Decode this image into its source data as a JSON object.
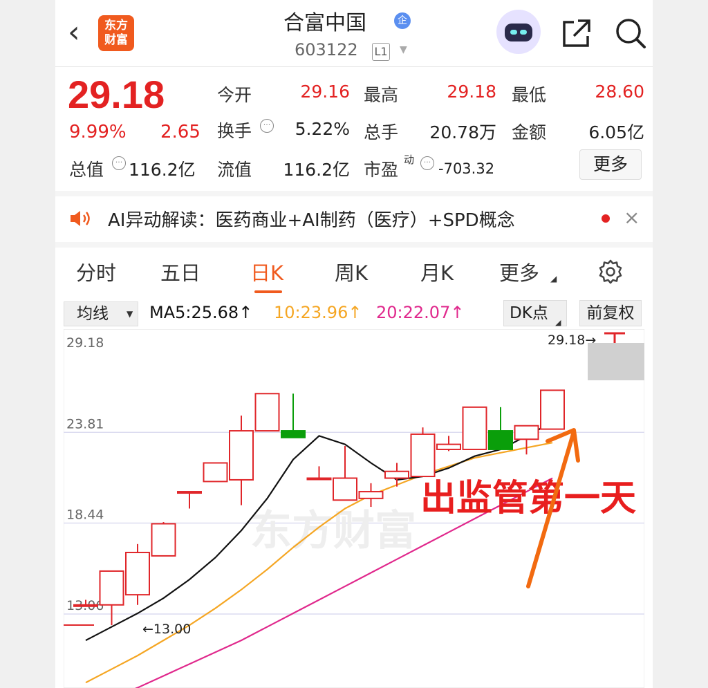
{
  "header": {
    "back_glyph": "‹",
    "logo_line1": "东方",
    "logo_line2": "财富",
    "title": "合富中国",
    "title_badge": "企",
    "code": "603122",
    "level": "L1"
  },
  "quote": {
    "price": "29.18",
    "change_pct": "9.99%",
    "change": "2.65",
    "stats": [
      {
        "label": "今开",
        "value": "29.16",
        "color": "#e32222"
      },
      {
        "label": "最高",
        "value": "29.18",
        "color": "#e32222"
      },
      {
        "label": "最低",
        "value": "28.60",
        "color": "#e32222"
      },
      {
        "label": "换手",
        "value": "5.22%",
        "color": "#222222"
      },
      {
        "label": "总手",
        "value": "20.78万",
        "color": "#222222"
      },
      {
        "label": "金额",
        "value": "6.05亿",
        "color": "#222222"
      },
      {
        "label": "总值",
        "value": "116.2亿",
        "color": "#222222"
      },
      {
        "label": "流值",
        "value": "116.2亿",
        "color": "#222222"
      },
      {
        "label": "市盈",
        "label_sup": "动",
        "value": "-703.32",
        "color": "#222222"
      }
    ],
    "more_label": "更多"
  },
  "ai_bar": {
    "text": "AI异动解读：医药商业+AI制药（医疗）+SPD概念",
    "close": "×"
  },
  "tabs": [
    "分时",
    "五日",
    "日K",
    "周K",
    "月K",
    "更多"
  ],
  "active_tab": "日K",
  "indicator": {
    "ma_selector": "均线",
    "ma5": "MA5:25.68↑",
    "ma10": "10:23.96↑",
    "ma20": "20:22.07↑",
    "ma5_color": "#111111",
    "ma10_color": "#f5a623",
    "ma20_color": "#e0288c",
    "dk_label": "DK点",
    "fq_label": "前复权"
  },
  "chart_data": {
    "type": "candlestick",
    "y_axis_labels": [
      "29.18",
      "23.81",
      "18.44",
      "13.06"
    ],
    "ylim": [
      11.0,
      29.18
    ],
    "annotations": {
      "high_label": "29.18→",
      "low_label": "←13.00",
      "overlay_text": "出监管第一天",
      "watermark": "东方财富"
    },
    "candles": [
      {
        "o": 13.6,
        "h": 13.9,
        "l": 13.6,
        "c": 13.6
      },
      {
        "o": 13.6,
        "h": 14.8,
        "l": 12.4,
        "c": 15.6
      },
      {
        "o": 14.2,
        "h": 17.2,
        "l": 13.6,
        "c": 16.7
      },
      {
        "o": 16.5,
        "h": 18.5,
        "l": 16.5,
        "c": 18.4
      },
      {
        "o": 20.3,
        "h": 20.3,
        "l": 19.3,
        "c": 20.3
      },
      {
        "o": 20.9,
        "h": 20.9,
        "l": 20.9,
        "c": 22.0
      },
      {
        "o": 21.0,
        "h": 24.8,
        "l": 19.5,
        "c": 23.9
      },
      {
        "o": 23.9,
        "h": 26.1,
        "l": 23.9,
        "c": 26.1
      },
      {
        "o": 23.9,
        "h": 26.1,
        "l": 23.5,
        "c": 23.5
      },
      {
        "o": 21.1,
        "h": 21.8,
        "l": 21.1,
        "c": 21.1
      },
      {
        "o": 19.8,
        "h": 23.0,
        "l": 19.8,
        "c": 21.1
      },
      {
        "o": 19.9,
        "h": 20.8,
        "l": 19.4,
        "c": 20.3
      },
      {
        "o": 21.1,
        "h": 22.0,
        "l": 20.6,
        "c": 21.5
      },
      {
        "o": 21.2,
        "h": 24.1,
        "l": 21.2,
        "c": 23.7
      },
      {
        "o": 22.8,
        "h": 23.6,
        "l": 22.7,
        "c": 23.1
      },
      {
        "o": 22.8,
        "h": 24.0,
        "l": 22.8,
        "c": 25.3
      },
      {
        "o": 23.9,
        "h": 25.3,
        "l": 22.8,
        "c": 22.8
      },
      {
        "o": 23.4,
        "h": 24.1,
        "l": 22.5,
        "c": 24.2
      },
      {
        "o": 24.0,
        "h": 26.3,
        "l": 24.0,
        "c": 26.3
      }
    ],
    "ma5": [
      11.5,
      12.3,
      13.1,
      14.0,
      15.1,
      16.4,
      18.0,
      19.9,
      22.2,
      23.6,
      23.1,
      22.0,
      21.0,
      21.2,
      21.7,
      22.4,
      22.8,
      23.6,
      24.4
    ],
    "ma10": [
      9.0,
      9.8,
      10.6,
      11.5,
      12.4,
      13.4,
      14.5,
      15.7,
      17.0,
      18.2,
      19.3,
      20.1,
      20.7,
      21.3,
      21.8,
      22.3,
      22.6,
      22.9,
      23.2
    ],
    "ma20": [
      7.5,
      8.1,
      8.7,
      9.4,
      10.1,
      10.8,
      11.5,
      12.3,
      13.1,
      13.9,
      14.7,
      15.5,
      16.3,
      17.1,
      17.9,
      18.7,
      19.5,
      20.3,
      21.1
    ]
  }
}
